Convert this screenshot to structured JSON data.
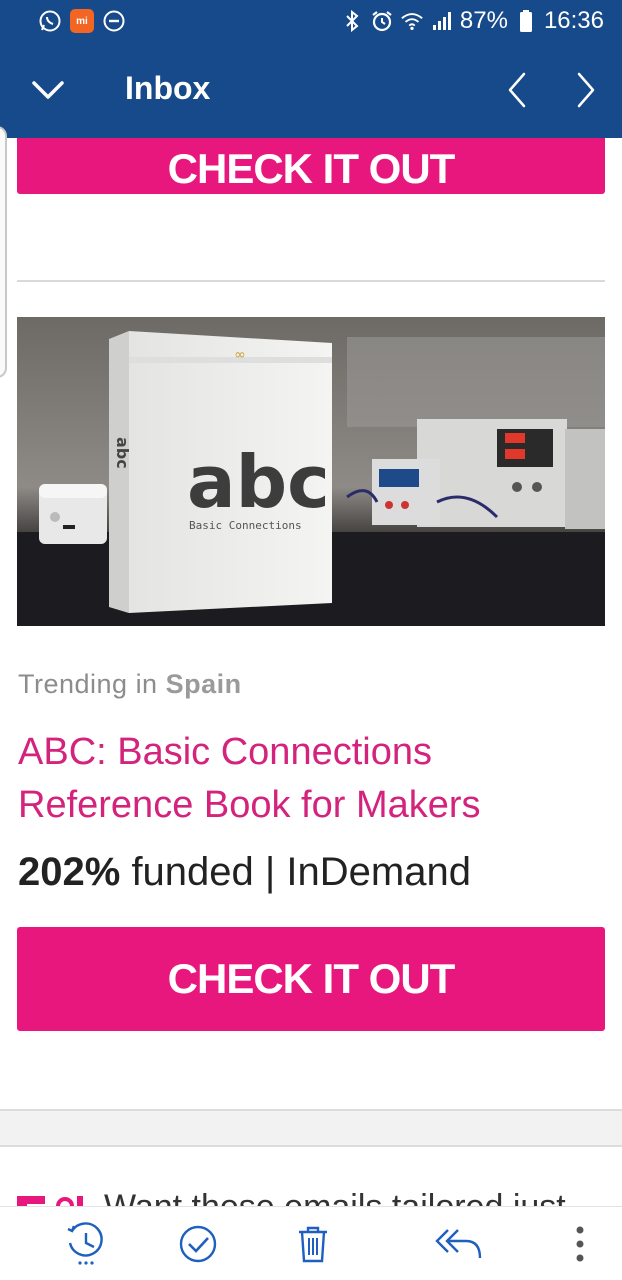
{
  "status_bar": {
    "battery": "87%",
    "time": "16:36",
    "left_icons": [
      "whatsapp-icon",
      "mi-app-icon",
      "do-not-disturb-icon"
    ],
    "right_icons": [
      "bluetooth-icon",
      "alarm-icon",
      "wifi-icon",
      "signal-icon",
      "battery-icon"
    ]
  },
  "header": {
    "title": "Inbox",
    "collapse_icon": "chevron-down-icon",
    "prev_icon": "chevron-left-icon",
    "next_icon": "chevron-right-icon"
  },
  "email": {
    "top_cta_label": "CHECK IT OUT",
    "trending_prefix": "Trending in",
    "trending_location": "Spain",
    "product_title": "ABC: Basic Connections Reference Book for Makers",
    "funded_percent": "202%",
    "funded_suffix": "funded | InDemand",
    "main_cta_label": "CHECK IT OUT",
    "hero_image": {
      "box_big_text": "abc",
      "box_subtitle": "Basic Connections",
      "box_spine_text": "abc"
    },
    "footer_text": "Want these emails tailored just"
  },
  "toolbar": {
    "items": [
      "snooze-icon",
      "mark-done-icon",
      "delete-icon",
      "reply-all-icon",
      "more-options-icon"
    ]
  },
  "colors": {
    "header_bg": "#174a8a",
    "cta_bg": "#e8177d",
    "title_color": "#d4237c",
    "toolbar_icon": "#1f5fbf"
  }
}
